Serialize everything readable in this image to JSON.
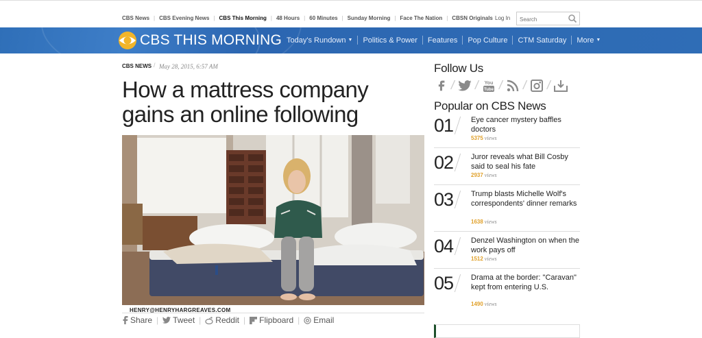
{
  "topnav": {
    "links": [
      {
        "label": "CBS News",
        "active": false
      },
      {
        "label": "CBS Evening News",
        "active": false
      },
      {
        "label": "CBS This Morning",
        "active": true
      },
      {
        "label": "48 Hours",
        "active": false
      },
      {
        "label": "60 Minutes",
        "active": false
      },
      {
        "label": "Sunday Morning",
        "active": false
      },
      {
        "label": "Face The Nation",
        "active": false
      },
      {
        "label": "CBSN Originals",
        "active": false
      }
    ],
    "login": "Log In",
    "search_placeholder": "Search"
  },
  "header": {
    "brand": "CBS THIS MORNING",
    "menu": [
      {
        "label": "Today's Rundown",
        "dropdown": true
      },
      {
        "label": "Politics & Power",
        "dropdown": false
      },
      {
        "label": "Features",
        "dropdown": false
      },
      {
        "label": "Pop Culture",
        "dropdown": false
      },
      {
        "label": "CTM Saturday",
        "dropdown": false
      },
      {
        "label": "More",
        "dropdown": true
      }
    ],
    "colors": {
      "bar": "#2f6db6",
      "eye": "#f2b52a"
    }
  },
  "article": {
    "kicker": "CBS NEWS",
    "date": "May 28, 2015, 6:57 AM",
    "headline": "How a mattress company gains an online following",
    "photo_credit": "HENRY@HENRYHARGREAVES.COM",
    "share": [
      {
        "icon": "facebook-icon",
        "label": "Share"
      },
      {
        "icon": "twitter-icon",
        "label": "Tweet"
      },
      {
        "icon": "reddit-icon",
        "label": "Reddit"
      },
      {
        "icon": "flipboard-icon",
        "label": "Flipboard"
      },
      {
        "icon": "email-icon",
        "label": "Email"
      }
    ]
  },
  "sidebar": {
    "follow_title": "Follow Us",
    "social_icons": [
      "facebook-icon",
      "twitter-icon",
      "youtube-icon",
      "rss-icon",
      "instagram-icon",
      "download-icon"
    ],
    "popular_title": "Popular on CBS News",
    "views_label": "views",
    "popular": [
      {
        "num": "01",
        "title": "Eye cancer mystery baffles doctors",
        "views": "5375"
      },
      {
        "num": "02",
        "title": "Juror reveals what Bill Cosby said to seal his fate",
        "views": "2937"
      },
      {
        "num": "03",
        "title": "Trump blasts Michelle Wolf's correspondents' dinner remarks",
        "views": "1638"
      },
      {
        "num": "04",
        "title": "Denzel Washington on when the work pays off",
        "views": "1512"
      },
      {
        "num": "05",
        "title": "Drama at the border: \"Caravan\" kept from entering U.S.",
        "views": "1490"
      }
    ]
  }
}
